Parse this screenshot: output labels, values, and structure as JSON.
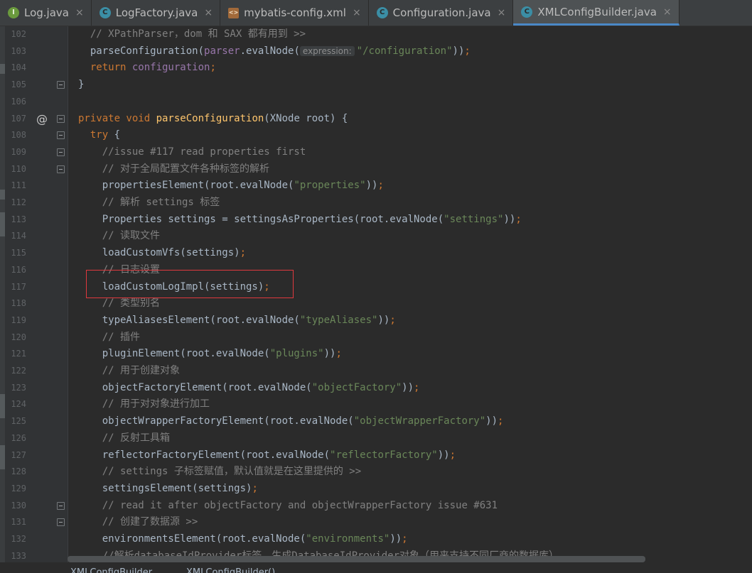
{
  "tabs": [
    {
      "icon": "interface",
      "label": "Log.java",
      "active": false
    },
    {
      "icon": "class",
      "label": "LogFactory.java",
      "active": false
    },
    {
      "icon": "xml",
      "label": "mybatis-config.xml",
      "active": false
    },
    {
      "icon": "class",
      "label": "Configuration.java",
      "active": false
    },
    {
      "icon": "class",
      "label": "XMLConfigBuilder.java",
      "active": true
    }
  ],
  "icons": {
    "interface": "I",
    "class": "C",
    "xml": "<>",
    "close": "×",
    "override": "@"
  },
  "colors": {
    "keyword": "#cc7832",
    "method": "#ffc66d",
    "string": "#6a8759",
    "comment": "#808080",
    "field": "#9876aa",
    "text": "#a9b7c6",
    "highlight_box": "#e0393e"
  },
  "lines": [
    {
      "n": "102",
      "t": [
        [
          "cm",
          "  // XPathParser，dom 和 SAX 都有用到 >>"
        ]
      ]
    },
    {
      "n": "103",
      "t": [
        [
          "p",
          "  parseConfiguration("
        ],
        [
          "fld",
          "parser"
        ],
        [
          "p",
          ".evalNode("
        ],
        [
          "hint",
          "expression:"
        ],
        [
          "str",
          "\"/configuration\""
        ],
        [
          "p",
          "))"
        ],
        [
          "semi",
          ";"
        ]
      ]
    },
    {
      "n": "104",
      "t": [
        [
          "kw",
          "  return "
        ],
        [
          "fld",
          "configuration"
        ],
        [
          "semi",
          ";"
        ]
      ]
    },
    {
      "n": "105",
      "t": [
        [
          "p",
          "}"
        ]
      ]
    },
    {
      "n": "106",
      "t": []
    },
    {
      "n": "107",
      "t": [
        [
          "kw",
          "private void "
        ],
        [
          "fn",
          "parseConfiguration"
        ],
        [
          "p",
          "(XNode root) {"
        ]
      ]
    },
    {
      "n": "108",
      "t": [
        [
          "kw",
          "  try "
        ],
        [
          "p",
          "{"
        ]
      ]
    },
    {
      "n": "109",
      "t": [
        [
          "cm",
          "    //issue #117 read properties first"
        ]
      ]
    },
    {
      "n": "110",
      "t": [
        [
          "cm",
          "    // 对于全局配置文件各种标签的解析"
        ]
      ]
    },
    {
      "n": "111",
      "t": [
        [
          "p",
          "    propertiesElement(root.evalNode("
        ],
        [
          "str",
          "\"properties\""
        ],
        [
          "p",
          "))"
        ],
        [
          "semi",
          ";"
        ]
      ]
    },
    {
      "n": "112",
      "t": [
        [
          "cm",
          "    // 解析 settings 标签"
        ]
      ]
    },
    {
      "n": "113",
      "t": [
        [
          "p",
          "    Properties settings = settingsAsProperties(root.evalNode("
        ],
        [
          "str",
          "\"settings\""
        ],
        [
          "p",
          "))"
        ],
        [
          "semi",
          ";"
        ]
      ]
    },
    {
      "n": "114",
      "t": [
        [
          "cm",
          "    // 读取文件"
        ]
      ]
    },
    {
      "n": "115",
      "t": [
        [
          "p",
          "    loadCustomVfs(settings)"
        ],
        [
          "semi",
          ";"
        ]
      ]
    },
    {
      "n": "116",
      "t": [
        [
          "cm",
          "    // 日志设置"
        ]
      ]
    },
    {
      "n": "117",
      "t": [
        [
          "p",
          "    loadCustomLogImpl(settings)"
        ],
        [
          "semi",
          ";"
        ]
      ]
    },
    {
      "n": "118",
      "t": [
        [
          "cm",
          "    // 类型别名"
        ]
      ]
    },
    {
      "n": "119",
      "t": [
        [
          "p",
          "    typeAliasesElement(root.evalNode("
        ],
        [
          "str",
          "\"typeAliases\""
        ],
        [
          "p",
          "))"
        ],
        [
          "semi",
          ";"
        ]
      ]
    },
    {
      "n": "120",
      "t": [
        [
          "cm",
          "    // 插件"
        ]
      ]
    },
    {
      "n": "121",
      "t": [
        [
          "p",
          "    pluginElement(root.evalNode("
        ],
        [
          "str",
          "\"plugins\""
        ],
        [
          "p",
          "))"
        ],
        [
          "semi",
          ";"
        ]
      ]
    },
    {
      "n": "122",
      "t": [
        [
          "cm",
          "    // 用于创建对象"
        ]
      ]
    },
    {
      "n": "123",
      "t": [
        [
          "p",
          "    objectFactoryElement(root.evalNode("
        ],
        [
          "str",
          "\"objectFactory\""
        ],
        [
          "p",
          "))"
        ],
        [
          "semi",
          ";"
        ]
      ]
    },
    {
      "n": "124",
      "t": [
        [
          "cm",
          "    // 用于对对象进行加工"
        ]
      ]
    },
    {
      "n": "125",
      "t": [
        [
          "p",
          "    objectWrapperFactoryElement(root.evalNode("
        ],
        [
          "str",
          "\"objectWrapperFactory\""
        ],
        [
          "p",
          "))"
        ],
        [
          "semi",
          ";"
        ]
      ]
    },
    {
      "n": "126",
      "t": [
        [
          "cm",
          "    // 反射工具箱"
        ]
      ]
    },
    {
      "n": "127",
      "t": [
        [
          "p",
          "    reflectorFactoryElement(root.evalNode("
        ],
        [
          "str",
          "\"reflectorFactory\""
        ],
        [
          "p",
          "))"
        ],
        [
          "semi",
          ";"
        ]
      ]
    },
    {
      "n": "128",
      "t": [
        [
          "cm",
          "    // settings 子标签赋值，默认值就是在这里提供的 >>"
        ]
      ]
    },
    {
      "n": "129",
      "t": [
        [
          "p",
          "    settingsElement(settings)"
        ],
        [
          "semi",
          ";"
        ]
      ]
    },
    {
      "n": "130",
      "t": [
        [
          "cm",
          "    // read it after objectFactory and objectWrapperFactory issue #631"
        ]
      ]
    },
    {
      "n": "131",
      "t": [
        [
          "cm",
          "    // 创建了数据源 >>"
        ]
      ]
    },
    {
      "n": "132",
      "t": [
        [
          "p",
          "    environmentsElement(root.evalNode("
        ],
        [
          "str",
          "\"environments\""
        ],
        [
          "p",
          "))"
        ],
        [
          "semi",
          ";"
        ]
      ]
    },
    {
      "n": "133",
      "t": [
        [
          "cm",
          "    //解析databaseIdProvider标签，生成DatabaseIdProvider对象（用来支持不同厂商的数据库）。"
        ]
      ]
    }
  ],
  "breadcrumb": [
    "XMLConfigBuilder",
    "XMLConfigBuilder()"
  ]
}
